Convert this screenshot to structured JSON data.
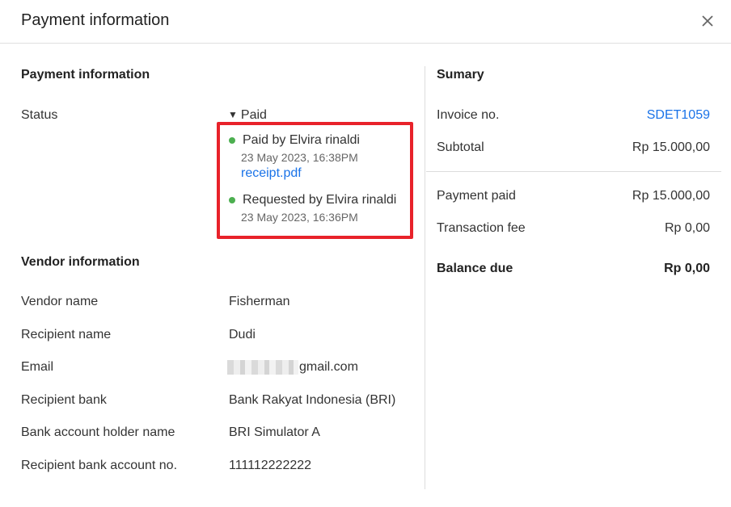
{
  "dialog": {
    "title": "Payment information"
  },
  "payment": {
    "section_title": "Payment information",
    "status_label": "Status",
    "status_value": "Paid",
    "events": [
      {
        "title": "Paid by Elvira rinaldi",
        "time": "23 May 2023, 16:38PM",
        "attachment": "receipt.pdf"
      },
      {
        "title": "Requested by Elvira rinaldi",
        "time": "23 May 2023, 16:36PM"
      }
    ],
    "colors": {
      "status_dot": "#4caf50",
      "highlight": "#e8222a",
      "link": "#1a73e8"
    }
  },
  "vendor": {
    "section_title": "Vendor information",
    "rows": [
      {
        "label": "Vendor name",
        "value": "Fisherman"
      },
      {
        "label": "Recipient name",
        "value": "Dudi"
      },
      {
        "label": "Email",
        "value": "gmail.com"
      },
      {
        "label": "Recipient bank",
        "value": "Bank Rakyat Indonesia (BRI)"
      },
      {
        "label": "Bank account holder name",
        "value": "BRI Simulator A"
      },
      {
        "label": "Recipient bank account no.",
        "value": "111112222222"
      }
    ]
  },
  "summary": {
    "section_title": "Sumary",
    "invoice_label": "Invoice no.",
    "invoice_value": "SDET1059",
    "subtotal_label": "Subtotal",
    "subtotal_value": "Rp 15.000,00",
    "payment_paid_label": "Payment paid",
    "payment_paid_value": "Rp 15.000,00",
    "fee_label": "Transaction fee",
    "fee_value": "Rp 0,00",
    "balance_label": "Balance due",
    "balance_value": "Rp 0,00"
  }
}
